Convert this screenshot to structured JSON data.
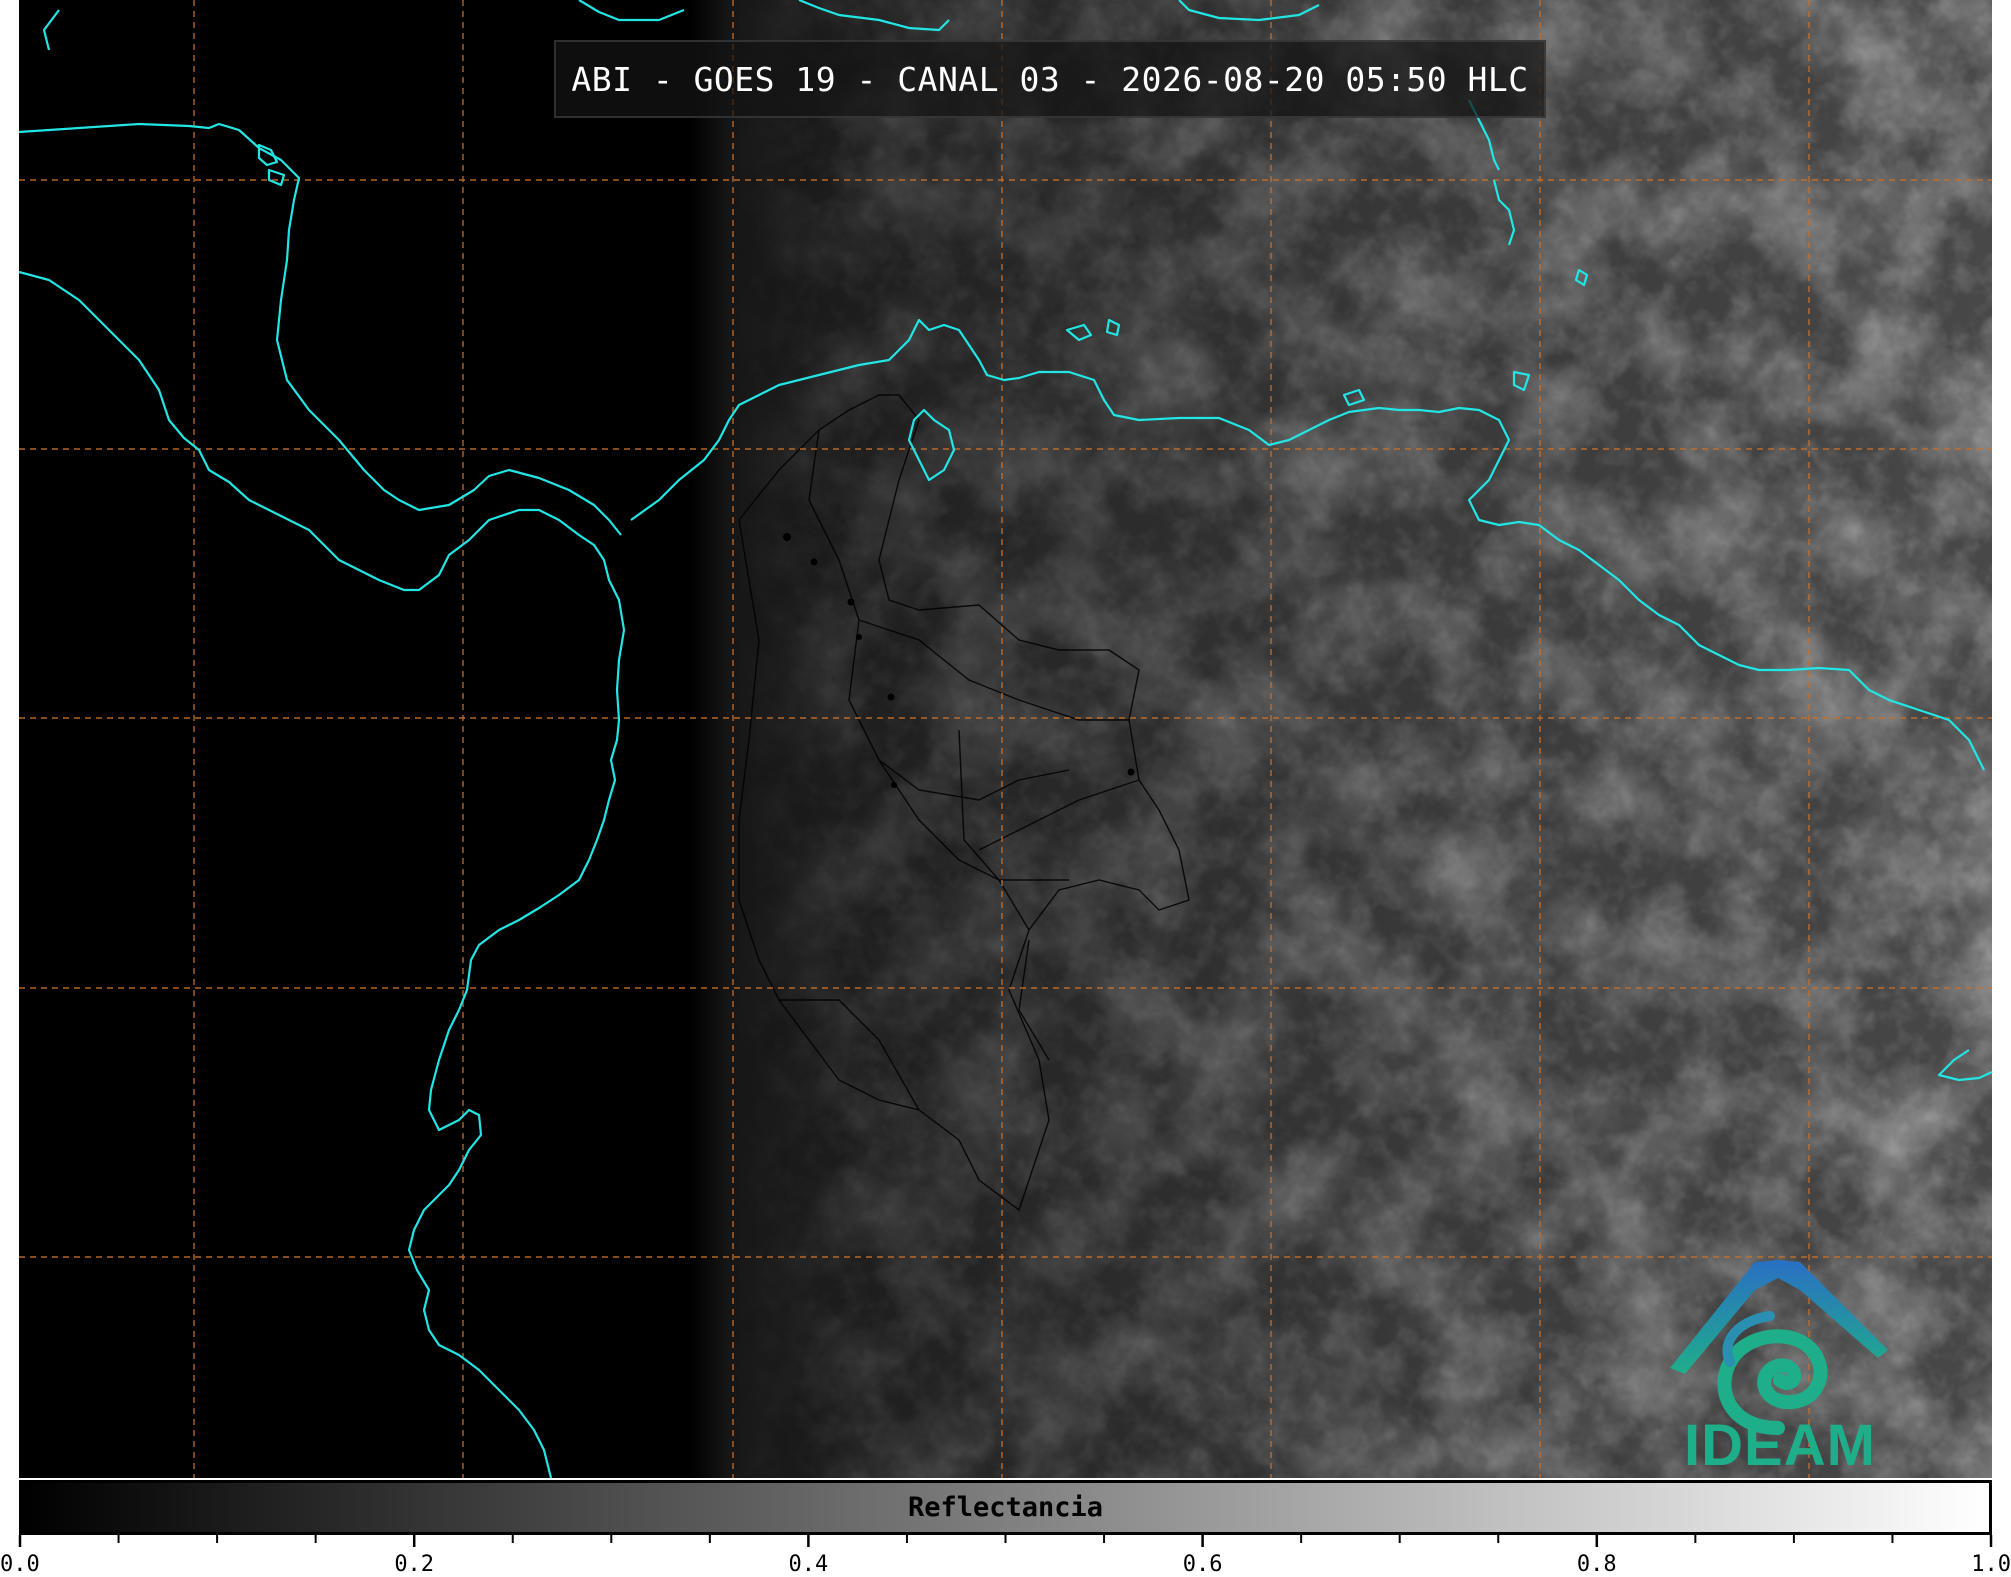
{
  "title": "ABI - GOES 19 - CANAL 03 - 2026-08-20 05:50 HLC",
  "colorbar": {
    "label": "Reflectancia",
    "range": [
      0.0,
      1.0
    ],
    "major_ticks": [
      "0.0",
      "0.2",
      "0.4",
      "0.6",
      "0.8",
      "1.0"
    ],
    "minor_tick_step": 0.05,
    "colormap": "grayscale"
  },
  "logo": {
    "text": "IDEAM"
  },
  "colors": {
    "coastline": "#22e6e6",
    "gridlines": "#c8702a",
    "borders": "#000000",
    "logo_green": "#1fae8a",
    "logo_blue": "#2a6fc4"
  },
  "map": {
    "gridlines": "dashed",
    "coastline_layer": "cyan",
    "borders_layer": "black"
  }
}
